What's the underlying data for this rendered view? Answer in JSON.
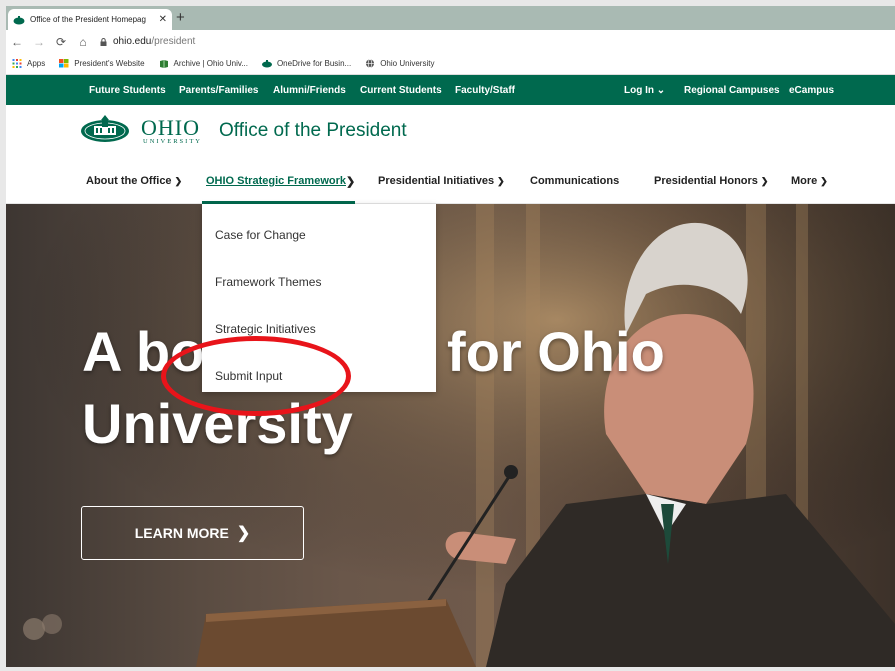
{
  "browser": {
    "tab_title": "Office of the President Homepag",
    "url_host": "ohio.edu",
    "url_path": "/president",
    "bookmarks": [
      {
        "label": "Apps",
        "icon": "apps-grid-icon"
      },
      {
        "label": "President's Website",
        "icon": "windows-logo-icon"
      },
      {
        "label": "Archive | Ohio Univ...",
        "icon": "archive-icon"
      },
      {
        "label": "OneDrive for Busin...",
        "icon": "ohio-seal-icon"
      },
      {
        "label": "Ohio University",
        "icon": "globe-icon"
      }
    ]
  },
  "utility_nav": {
    "items": [
      "Future Students",
      "Parents/Families",
      "Alumni/Friends",
      "Current Students",
      "Faculty/Staff"
    ],
    "login": "Log In",
    "regional": "Regional Campuses",
    "ecampus": "eCampus"
  },
  "brand": {
    "ohio": "OHIO",
    "university": "UNIVERSITY",
    "office": "Office of the President"
  },
  "main_nav": {
    "items": [
      {
        "label": "About the Office",
        "has_chevron": true
      },
      {
        "label": "OHIO Strategic Framework",
        "active": true
      },
      {
        "label": "Presidential Initiatives",
        "has_chevron": true
      },
      {
        "label": "Communications",
        "has_chevron": false
      },
      {
        "label": "Presidential Honors",
        "has_chevron": true
      },
      {
        "label": "More",
        "has_chevron": true
      }
    ]
  },
  "dropdown": {
    "items": [
      "Case for Change",
      "Framework Themes",
      "Strategic Initiatives",
      "Submit Input"
    ]
  },
  "hero": {
    "headline_line1": "A bold vision for Ohio",
    "headline_line2": "University",
    "cta": "LEARN MORE"
  },
  "colors": {
    "brand_green": "#00694e",
    "annotation_red": "#e8141a"
  }
}
